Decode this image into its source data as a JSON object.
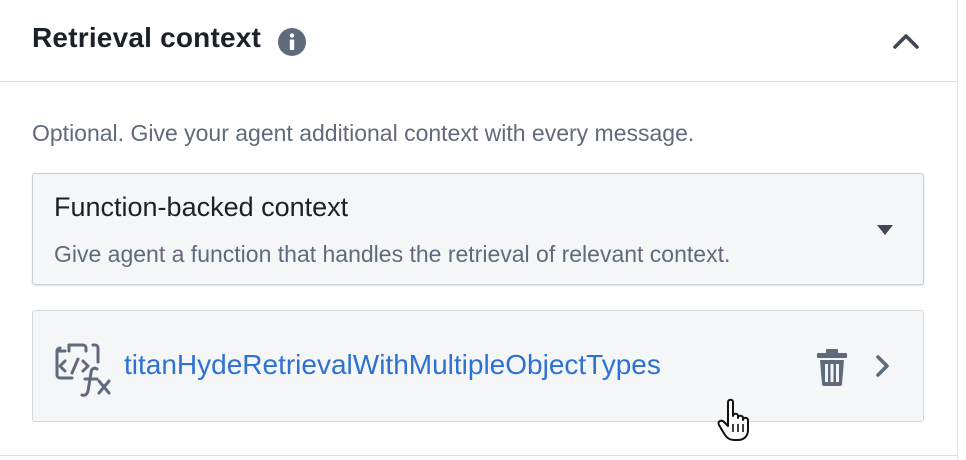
{
  "section": {
    "title": "Retrieval context",
    "info_icon": "info-icon",
    "collapse_icon": "chevron-up-icon"
  },
  "description": "Optional. Give your agent additional context with every message.",
  "context_select": {
    "selected_title": "Function-backed context",
    "selected_description": "Give agent a function that handles the retrieval of relevant context.",
    "caret_icon": "caret-down-icon"
  },
  "function_item": {
    "icon": "function-icon",
    "name": "titanHydeRetrievalWithMultipleObjectTypes",
    "delete_icon": "trash-icon",
    "open_icon": "chevron-right-icon"
  },
  "colors": {
    "link": "#2d72d2",
    "muted_text": "#5f6b7c",
    "card_bg": "#f5f6f8",
    "icon_gray": "#5f6b7c"
  }
}
